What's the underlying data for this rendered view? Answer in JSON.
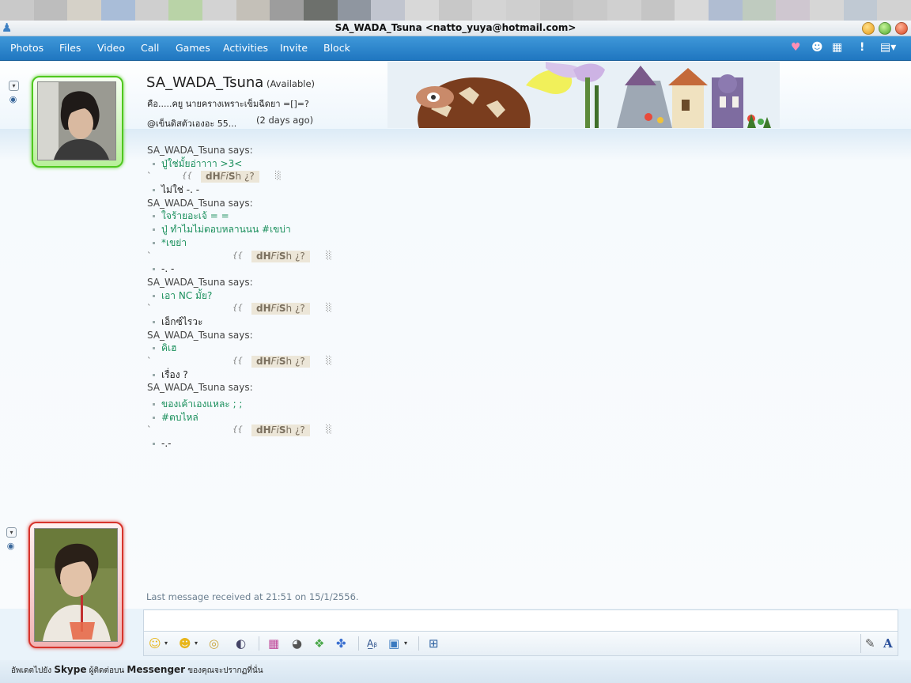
{
  "window": {
    "title": "SA_WADA_Tsuna <natto_yuya@hotmail.com>"
  },
  "desktop_strip_colors": [
    "#c9c9c9",
    "#bdbdbd",
    "#d5d1c8",
    "#a9bdd8",
    "#cfcfcf",
    "#b9d3a7",
    "#d3d3d3",
    "#c4c0b8",
    "#9d9d9d",
    "#6d706c",
    "#8f96a0",
    "#c1c5cf",
    "#d8d8d8",
    "#c8c8c8",
    "#d4d4d4",
    "#cfcfcf",
    "#c3c3c3",
    "#c9c9c9",
    "#d0d0d0",
    "#c5c5c5",
    "#d9d9d9",
    "#b0bdd2",
    "#bfcbbf",
    "#cfc7d0",
    "#d6d6d6",
    "#c0c9d3",
    "#d2d2d2"
  ],
  "toolbar": {
    "items": [
      "Photos",
      "Files",
      "Video",
      "Call",
      "Games",
      "Activities",
      "Invite",
      "Block"
    ],
    "right_icons": [
      "heart-icon",
      "emoticon-face-icon",
      "keyboard-icon",
      "alert-icon",
      "menu-dropdown-icon"
    ]
  },
  "contact": {
    "name": "SA_WADA_Tsuna",
    "status": "(Available)",
    "personal_message": "คือ.....คยู นายครางเพราะเข็มฉีดยา =[]=?",
    "news_item": "@เข็นดิสตัวเองอะ 55...",
    "news_time": "(2 days ago)"
  },
  "conversation": {
    "says_label": "SA_WADA_Tsuna says:",
    "signature": {
      "brace": "{{",
      "name_bold1": "dH",
      "name_italic": "Fi",
      "name_bold2": "S",
      "name_tail": "h ¿?",
      "tick": "`",
      "scroll": "░"
    },
    "blocks": [
      {
        "type": "incoming",
        "lines": [
          "ปู่ใช่มั้ยอ่าาาา >3<"
        ]
      },
      {
        "type": "outgoing",
        "lines": [
          "ไม่ใช่ -. -"
        ]
      },
      {
        "type": "incoming",
        "lines": [
          "ใจร้ายอะเจ้ = =",
          "ปู่ ทำไมไม่ตอบหลานนน #เขบ่า",
          "*เขย่า"
        ]
      },
      {
        "type": "outgoing",
        "lines": [
          "-. -"
        ]
      },
      {
        "type": "incoming",
        "lines": [
          "เอา NC มั้ย?"
        ]
      },
      {
        "type": "outgoing",
        "lines": [
          "เอ็กซ์ไรวะ"
        ]
      },
      {
        "type": "incoming",
        "lines": [
          "คิเฮ"
        ]
      },
      {
        "type": "outgoing",
        "lines": [
          "เรื่อง ?"
        ]
      },
      {
        "type": "incoming",
        "lines": [
          "ของเค้าเองแหละ ;       ;",
          "#ตบไหล่"
        ]
      },
      {
        "type": "outgoing",
        "lines": [
          "-.-"
        ]
      }
    ],
    "last_message": "Last message received at 21:51 on 15/1/2556."
  },
  "input_toolbar": {
    "left_icons": [
      "smiley-icon",
      "wink-icon",
      "nudge-icon",
      "voice-clip-icon"
    ],
    "mid_icons": [
      "backgrounds-icon",
      "nudge-shake-icon",
      "winks-icon",
      "games-icon"
    ],
    "right_icons": [
      "font-icon",
      "image-icon"
    ],
    "extra_icons": [
      "contacts-icon"
    ],
    "far_right": [
      "handwriting-icon",
      "text-style-icon"
    ]
  },
  "footer": {
    "prefix": "อัพเดตไปยัง ",
    "skype": "Skype",
    "middle": " ผู้ติดต่อบน ",
    "messenger": "Messenger",
    "suffix": " ของคุณจะปรากฏที่นั่น"
  }
}
